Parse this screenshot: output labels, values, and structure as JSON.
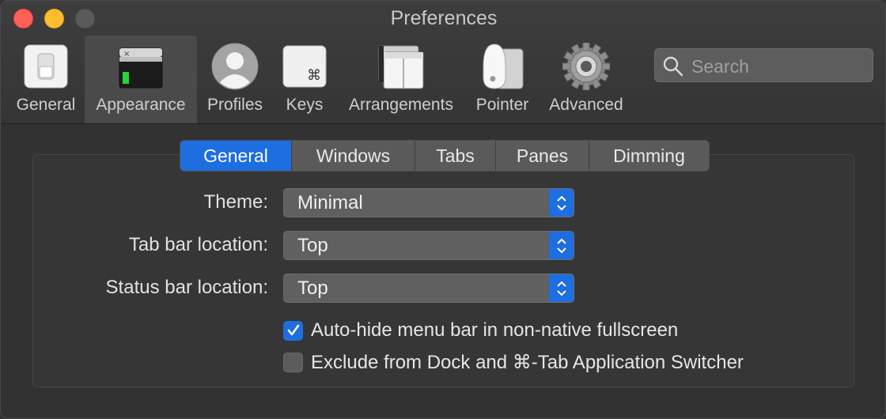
{
  "window": {
    "title": "Preferences"
  },
  "toolbar": {
    "items": [
      {
        "label": "General",
        "icon": "general-switch-icon"
      },
      {
        "label": "Appearance",
        "icon": "appearance-terminal-icon"
      },
      {
        "label": "Profiles",
        "icon": "profile-person-icon"
      },
      {
        "label": "Keys",
        "icon": "command-key-icon"
      },
      {
        "label": "Arrangements",
        "icon": "arrangements-windows-icon"
      },
      {
        "label": "Pointer",
        "icon": "mouse-icon"
      },
      {
        "label": "Advanced",
        "icon": "gear-icon"
      }
    ],
    "selected": "Appearance"
  },
  "search": {
    "placeholder": "Search",
    "value": ""
  },
  "tabs": {
    "items": [
      "General",
      "Windows",
      "Tabs",
      "Panes",
      "Dimming"
    ],
    "selected": "General"
  },
  "form": {
    "theme": {
      "label": "Theme:",
      "value": "Minimal"
    },
    "tab_bar_location": {
      "label": "Tab bar location:",
      "value": "Top"
    },
    "status_bar_location": {
      "label": "Status bar location:",
      "value": "Top"
    },
    "auto_hide": {
      "label": "Auto-hide menu bar in non-native fullscreen",
      "checked": true
    },
    "exclude_dock": {
      "label": "Exclude from Dock and ⌘-Tab Application Switcher",
      "checked": false
    }
  },
  "colors": {
    "accent": "#1d6ee0",
    "background": "#323232",
    "close": "#fe5f57",
    "minimize": "#febc2e"
  }
}
